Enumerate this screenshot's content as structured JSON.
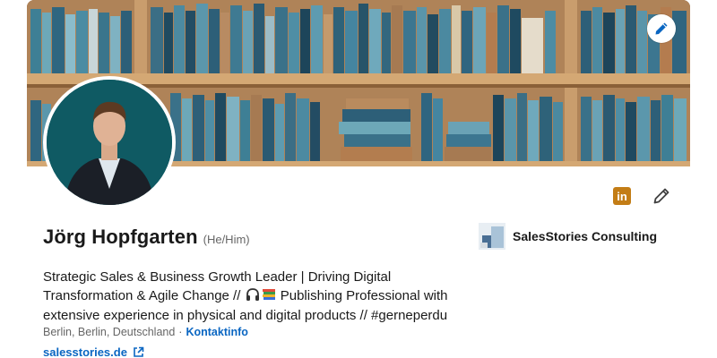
{
  "profile": {
    "name": "Jörg Hopfgarten",
    "pronouns": "(He/Him)",
    "headline_part1": "Strategic Sales & Business Growth Leader | Driving Digital Transformation & Agile Change // ",
    "headline_part2": " Publishing Professional with extensive experience in physical and digital products // #gerneperdu",
    "location": "Berlin, Berlin, Deutschland",
    "separator": "·",
    "contact_label": "Kontaktinfo",
    "website": "salesstories.de"
  },
  "company": {
    "name": "SalesStories Consulting"
  },
  "actions": {
    "linkedin_badge": "in"
  },
  "colors": {
    "link": "#0a66c2",
    "linkedin_badge": "#c37d16",
    "avatar_bg": "#0f5a63"
  },
  "icons": [
    "edit-banner-pencil-icon",
    "linkedin-icon",
    "edit-pencil-icon",
    "headphones-emoji",
    "books-emoji",
    "external-link-icon"
  ]
}
